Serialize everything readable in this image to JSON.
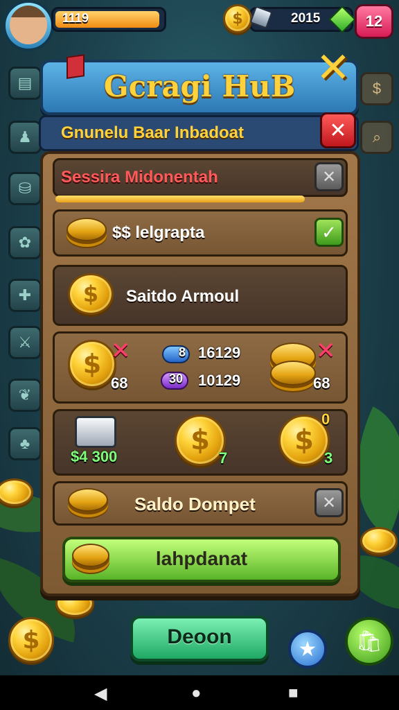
{
  "hud": {
    "hp_value": "1119",
    "gold_value": "2015",
    "notification_count": "12"
  },
  "modal": {
    "title": "Gcragi HuB",
    "subtitle": "Gnunelu Baar Inbadoat",
    "rows": {
      "session_label": "Sessira Midonentah",
      "telegraph_label": "$$ lelgrapta",
      "saldo_amount_label": "Saitdo Armoul",
      "saldo_dompet_label": "Saldo Dompet"
    },
    "stats": {
      "left_coin_value": "68",
      "right_coin_value": "68",
      "stat_1": "16129",
      "stat_2": "10129",
      "pill_1": "8",
      "pill_2": "30",
      "chest_value": "$4 300",
      "mid_coin_value": "7",
      "right_coin_small": "3",
      "right_coin_badge": "0"
    },
    "action_button": "lahpdanat"
  },
  "bottom": {
    "main_button": "Deoon"
  },
  "navbar": {
    "back": "◀",
    "home": "●",
    "recent": "■"
  },
  "colors": {
    "title_gold": "#ffd23c",
    "panel_brown": "#8e6b44",
    "action_green": "#5ab428",
    "close_red": "#c0171c"
  }
}
